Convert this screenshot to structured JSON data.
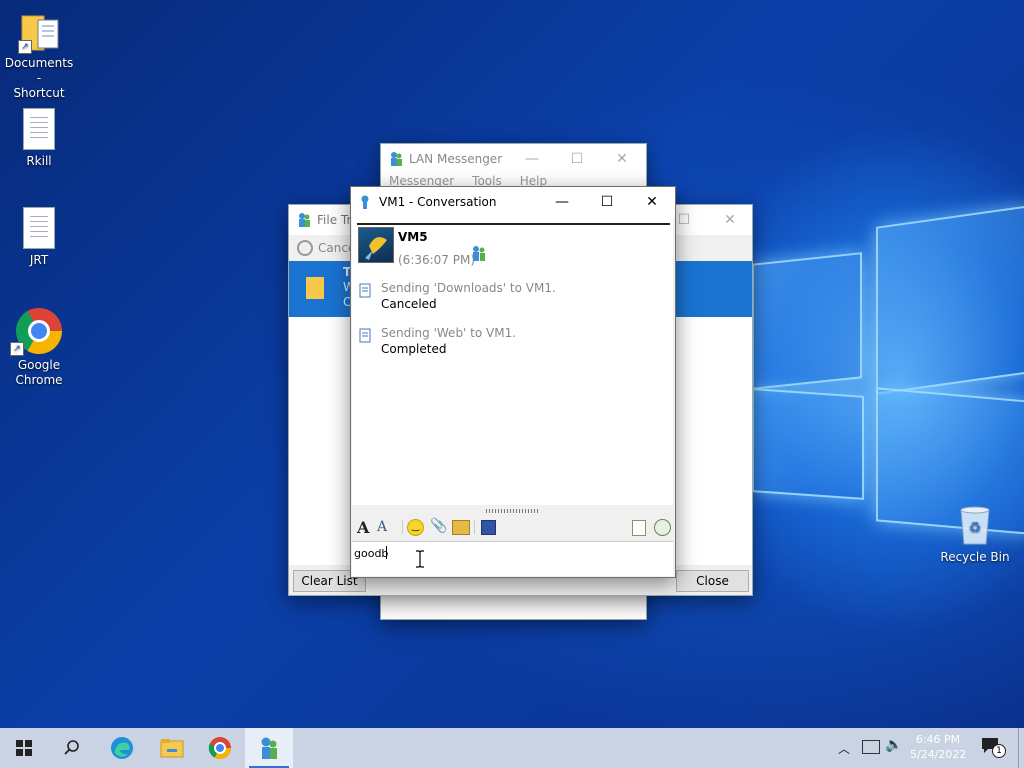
{
  "desktop": {
    "icons": [
      {
        "label": "Documents -\nShortcut",
        "icon": "folder-shortcut-icon"
      },
      {
        "label": "Rkill",
        "icon": "document-icon"
      },
      {
        "label": "JRT",
        "icon": "document-icon"
      },
      {
        "label": "Google\nChrome",
        "icon": "chrome-icon"
      },
      {
        "label": "Recycle Bin",
        "icon": "recycle-bin-icon"
      }
    ]
  },
  "lan_messenger": {
    "title": "LAN Messenger",
    "menu": [
      "Messenger",
      "Tools",
      "Help"
    ]
  },
  "file_transfer": {
    "title": "File Tra",
    "cancel_label": "Cancel",
    "row_title": "T",
    "row_line2": "W",
    "row_line3": "C",
    "clear_list_label": "Clear List",
    "close_label": "Close"
  },
  "conversation": {
    "title": "VM1 - Conversation",
    "user_name": "VM5",
    "timestamp": "(6:36:07 PM)",
    "messages": [
      {
        "text": "Sending 'Downloads' to VM1.",
        "status": "Canceled"
      },
      {
        "text": "Sending 'Web' to VM1.",
        "status": "Completed"
      }
    ],
    "input_value": "goodb"
  },
  "taskbar": {
    "time": "6:46 PM",
    "date": "5/24/2022",
    "notification_count": "1"
  }
}
